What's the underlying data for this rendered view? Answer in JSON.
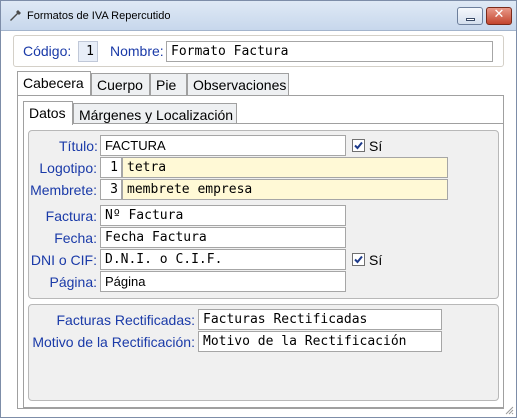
{
  "window": {
    "title": "Formatos de IVA Repercutido",
    "close_label": "✕"
  },
  "header": {
    "codigo_label": "Código:",
    "codigo_value": "1",
    "nombre_label": "Nombre:",
    "nombre_value": "Formato Factura"
  },
  "outer_tabs": [
    {
      "label": "Cabecera",
      "active": true
    },
    {
      "label": "Cuerpo",
      "active": false
    },
    {
      "label": "Pie",
      "active": false
    },
    {
      "label": "Observaciones",
      "active": false
    }
  ],
  "inner_tabs": [
    {
      "label": "Datos",
      "active": true
    },
    {
      "label": "Márgenes y Localización",
      "active": false
    }
  ],
  "datos": {
    "titulo": {
      "label": "Título:",
      "value": "FACTURA",
      "check_label": "Sí",
      "checked": true
    },
    "logotipo": {
      "label": "Logotipo:",
      "num": "1",
      "value": "tetra"
    },
    "membrete": {
      "label": "Membrete:",
      "num": "3",
      "value": "membrete empresa"
    },
    "factura": {
      "label": "Factura:",
      "value": "Nº Factura"
    },
    "fecha": {
      "label": "Fecha:",
      "value": "Fecha Factura"
    },
    "dni": {
      "label": "DNI o CIF:",
      "value": "D.N.I. o C.I.F.",
      "check_label": "Sí",
      "checked": true
    },
    "pagina": {
      "label": "Página:",
      "value": "Página"
    }
  },
  "rectificacion": {
    "facturas_label": "Facturas Rectificadas:",
    "facturas_value": "Facturas Rectificadas",
    "motivo_label": "Motivo de la Rectificación:",
    "motivo_value": "Motivo de la Rectificación"
  },
  "colors": {
    "label_blue": "#1a3aa8",
    "lookup_yellow": "#fff9d6",
    "titlebar": "#c7d7ec"
  }
}
